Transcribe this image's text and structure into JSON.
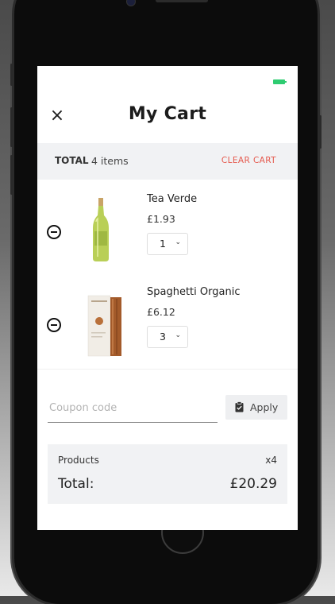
{
  "header": {
    "title": "My Cart",
    "close_icon": "×"
  },
  "status_bar": {
    "battery_color": "#2ecc71"
  },
  "total_bar": {
    "label": "TOTAL",
    "items_count": "4 items",
    "clear_label": "CLEAR CART"
  },
  "items": [
    {
      "name": "Tea Verde",
      "price": "£1.93",
      "quantity": "1",
      "image_icon": "green-tea-bottle"
    },
    {
      "name": "Spaghetti Organic",
      "price": "£6.12",
      "quantity": "3",
      "image_icon": "spaghetti-box"
    }
  ],
  "coupon": {
    "placeholder": "Coupon code",
    "apply_label": "Apply"
  },
  "summary": {
    "products_label": "Products",
    "products_count": "x4",
    "total_label": "Total:",
    "total_value": "£20.29"
  },
  "colors": {
    "accent_red": "#e5594d",
    "panel_grey": "#f1f2f4",
    "text_dark": "#1c1c1c"
  }
}
